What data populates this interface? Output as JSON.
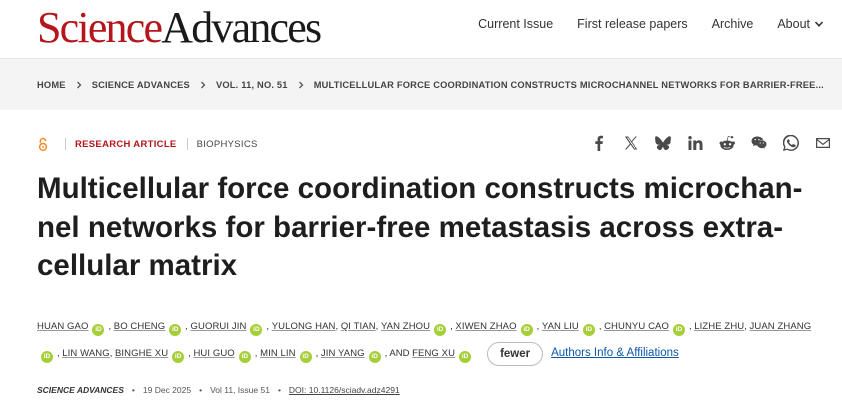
{
  "logo": {
    "part1": "Science",
    "part2": "Advances"
  },
  "nav": [
    {
      "label": "Current Issue"
    },
    {
      "label": "First release papers"
    },
    {
      "label": "Archive"
    },
    {
      "label": "About"
    }
  ],
  "breadcrumb": [
    "HOME",
    "SCIENCE ADVANCES",
    "VOL. 11, NO. 51",
    "MULTICELLULAR FORCE COORDINATION CONSTRUCTS MICROCHANNEL NETWORKS FOR BARRIER-FREE..."
  ],
  "article": {
    "type": "RESEARCH ARTICLE",
    "subject": "BIOPHYSICS",
    "title": "Multicellular force coordination constructs microchan-nel networks for barrier-free metastasis across extra-cellular matrix"
  },
  "share_icons": [
    "facebook-icon",
    "x-icon",
    "bluesky-icon",
    "linkedin-icon",
    "reddit-icon",
    "wechat-icon",
    "whatsapp-icon",
    "email-icon"
  ],
  "authors": {
    "list": [
      {
        "name": "HUAN GAO",
        "orcid": true
      },
      {
        "name": "BO CHENG",
        "orcid": true
      },
      {
        "name": "GUORUI JIN",
        "orcid": true
      },
      {
        "name": "YULONG HAN",
        "orcid": false
      },
      {
        "name": "QI TIAN",
        "orcid": false
      },
      {
        "name": "YAN ZHOU",
        "orcid": true
      },
      {
        "name": "XIWEN ZHAO",
        "orcid": true
      },
      {
        "name": "YAN LIU",
        "orcid": true
      },
      {
        "name": "CHUNYU CAO",
        "orcid": true
      },
      {
        "name": "LIZHE ZHU",
        "orcid": false
      },
      {
        "name": "JUAN ZHANG",
        "orcid": true
      },
      {
        "name": "LIN WANG",
        "orcid": false
      },
      {
        "name": "BINGHE XU",
        "orcid": true
      },
      {
        "name": "HUI GUO",
        "orcid": true
      },
      {
        "name": "MIN LIN",
        "orcid": true
      },
      {
        "name": "JIN YANG",
        "orcid": true
      },
      {
        "name": "FENG XU",
        "orcid": true
      }
    ],
    "and_label": "AND",
    "orcid_label": "iD",
    "fewer_label": "fewer",
    "affiliations_label": "Authors Info & Affiliations"
  },
  "footer": {
    "journal": "SCIENCE ADVANCES",
    "date": "19 Dec 2025",
    "volume": "Vol 11, Issue 51",
    "doi": "DOI: 10.1126/sciadv.adz4291"
  }
}
